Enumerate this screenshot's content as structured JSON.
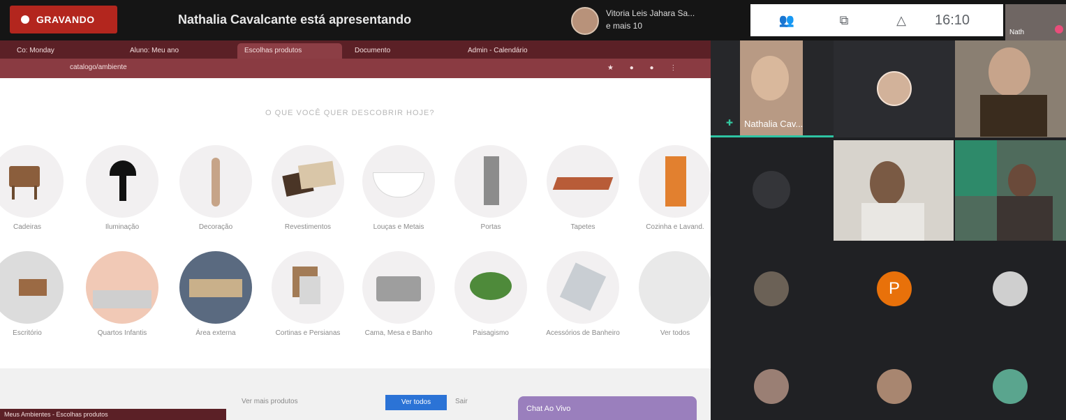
{
  "recording": {
    "label": "GRAVANDO",
    "color": "#b3261e"
  },
  "presentation": {
    "text": "Nathalia Cavalcante está apresentando"
  },
  "participants_header": {
    "line1": "Vitoria Leis Jahara Sa...",
    "line2": "e mais 10"
  },
  "meet_toolbar": {
    "icons": [
      "people-icon",
      "present-screen-icon",
      "activities-icon"
    ],
    "clock": "16:10"
  },
  "self_view": {
    "name": "Nath"
  },
  "browser": {
    "tabs": [
      "Co: Monday",
      "Aluno: Meu ano",
      "Escolhas produtos",
      "Documento",
      "Admin - Calendário"
    ],
    "url": "catalogo/ambiente",
    "accent": "#5b2026"
  },
  "page": {
    "question": "O QUE VOCÊ QUER DESCOBRIR HOJE?",
    "row1": [
      {
        "label": "Cadeiras"
      },
      {
        "label": "Iluminação"
      },
      {
        "label": "Decoração"
      },
      {
        "label": "Revestimentos"
      },
      {
        "label": "Louças e Metais"
      },
      {
        "label": "Portas"
      },
      {
        "label": "Tapetes"
      },
      {
        "label": "Cozinha e Lavand."
      }
    ],
    "row2": [
      {
        "label": "Escritório"
      },
      {
        "label": "Quartos Infantis"
      },
      {
        "label": "Área externa"
      },
      {
        "label": "Cortinas e Persianas"
      },
      {
        "label": "Cama, Mesa e Banho"
      },
      {
        "label": "Paisagismo"
      },
      {
        "label": "Acessórios de Banheiro"
      },
      {
        "label": "Ver todos"
      }
    ],
    "footer_text": "Ver mais produtos",
    "footer_button": "Ver todos",
    "footer_link": "Sair",
    "footer_card": "Chat Ao Vivo",
    "footer_tab": "Meus Ambientes - Escolhas produtos"
  },
  "grid": {
    "tiles": [
      {
        "name": "Nathalia Cav...",
        "type": "video",
        "pinned": true
      },
      {
        "name": "",
        "type": "avatar"
      },
      {
        "name": "",
        "type": "video"
      },
      {
        "name": "",
        "type": "avatar-dim"
      },
      {
        "name": "",
        "type": "video"
      },
      {
        "name": "",
        "type": "video"
      },
      {
        "name": "",
        "type": "avatar"
      },
      {
        "name": "P",
        "type": "initial",
        "color": "#e8710a"
      },
      {
        "name": "",
        "type": "avatar"
      },
      {
        "name": "",
        "type": "avatar"
      },
      {
        "name": "",
        "type": "avatar"
      },
      {
        "name": "",
        "type": "avatar"
      }
    ]
  }
}
